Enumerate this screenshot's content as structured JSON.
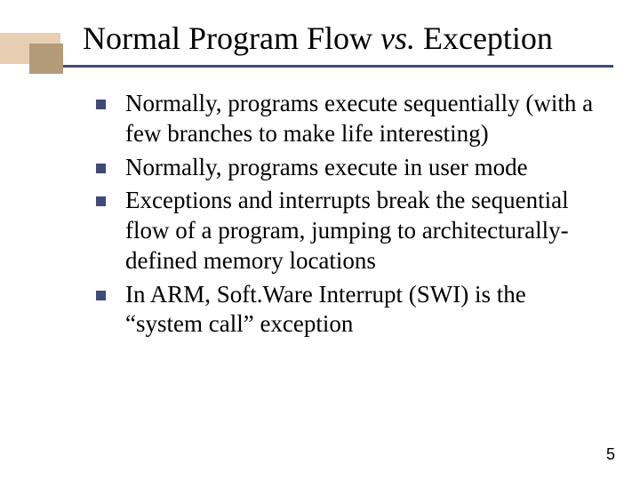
{
  "title": {
    "pre": "Normal Program Flow ",
    "vs": "vs.",
    "post": " Exception"
  },
  "bullets": [
    "Normally, programs execute sequentially (with a few branches to make life interesting)",
    "Normally, programs execute in user mode",
    "Exceptions and interrupts break the sequential flow of a program, jumping to architecturally-defined memory locations",
    "In ARM, Soft.Ware Interrupt (SWI) is the “system call” exception"
  ],
  "pageNumber": "5"
}
